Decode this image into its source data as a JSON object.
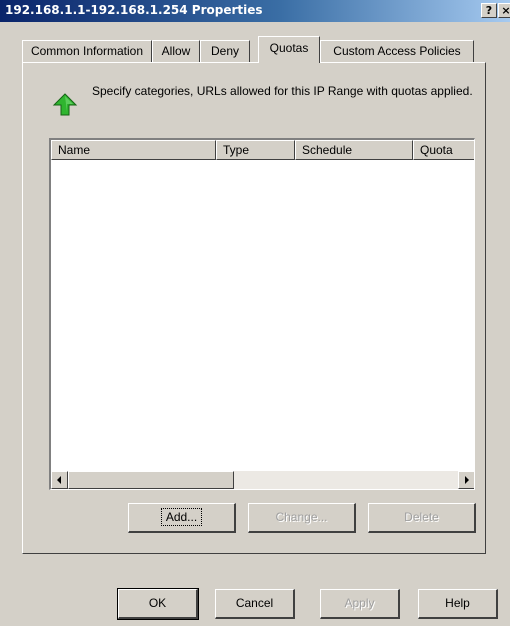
{
  "window": {
    "title": "192.168.1.1-192.168.1.254 Properties",
    "help_button": "?",
    "close_button": "×"
  },
  "tabs": [
    {
      "label": "Common Information",
      "active": false
    },
    {
      "label": "Allow",
      "active": false
    },
    {
      "label": "Deny",
      "active": false
    },
    {
      "label": "Quotas",
      "active": true
    },
    {
      "label": "Custom Access Policies",
      "active": false
    }
  ],
  "quotas": {
    "info_icon": "green-up-arrow-icon",
    "description": "Specify categories, URLs allowed for this IP Range with quotas applied.",
    "list": {
      "columns": [
        "Name",
        "Type",
        "Schedule",
        "Quota"
      ],
      "rows": []
    },
    "buttons": {
      "add": "Add...",
      "change": "Change...",
      "delete": "Delete"
    }
  },
  "footer": {
    "ok": "OK",
    "cancel": "Cancel",
    "apply": "Apply",
    "help": "Help"
  },
  "colors": {
    "title_start": "#0a246a",
    "title_end": "#a6caf0",
    "dialog_bg": "#d4d0c8",
    "icon_green": "#2fb52f"
  }
}
